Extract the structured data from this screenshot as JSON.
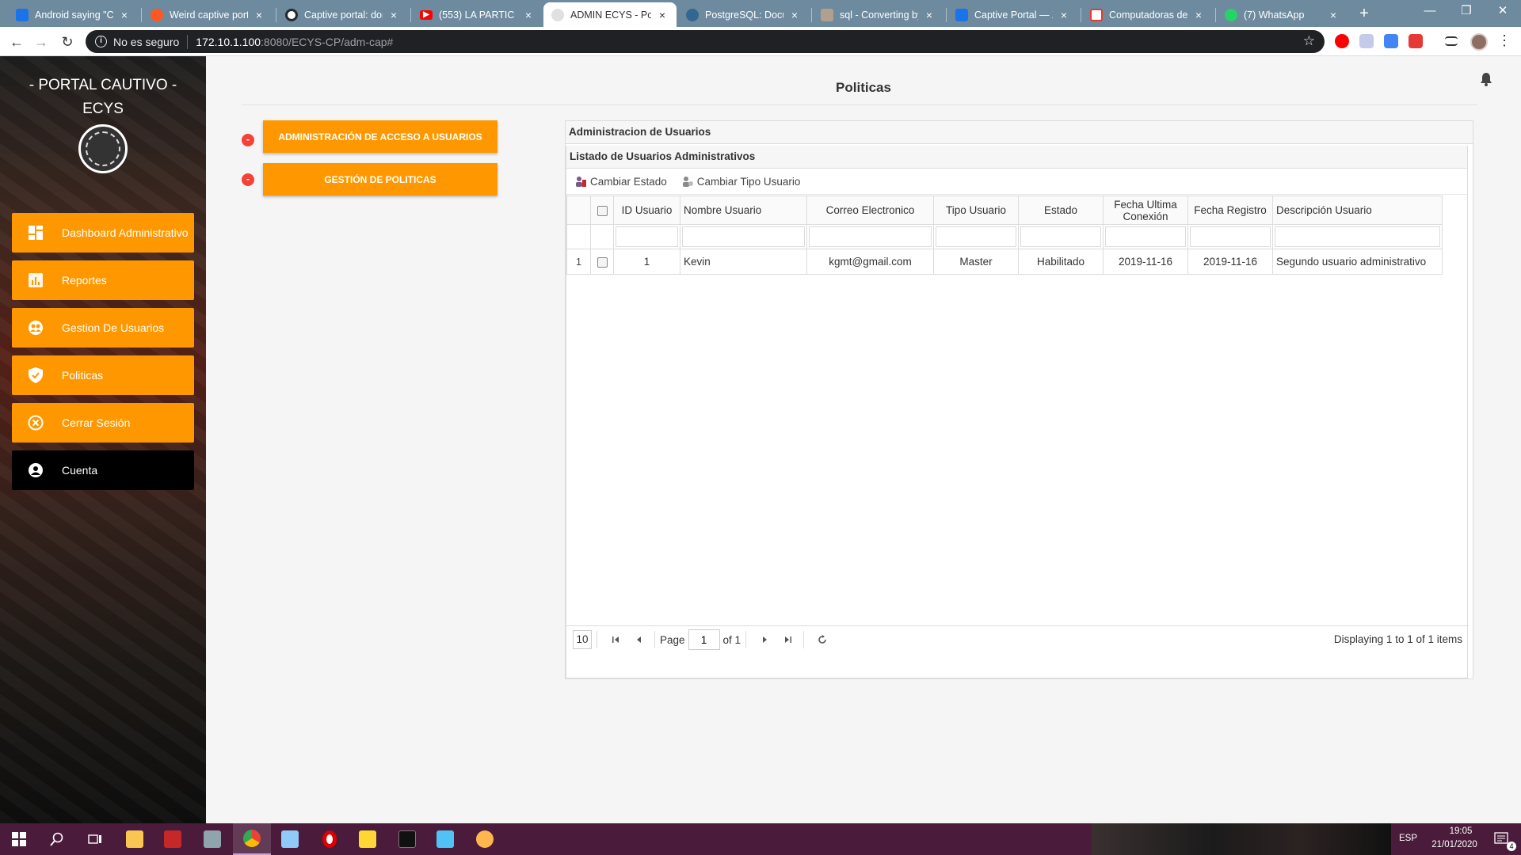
{
  "browser": {
    "tabs": [
      {
        "title": "Android saying \"Co",
        "favicon_color": "#1a73e8"
      },
      {
        "title": "Weird captive porta",
        "favicon_color": "#ff5722"
      },
      {
        "title": "Captive portal: don",
        "favicon_color": "#24292e"
      },
      {
        "title": "(553) LA PARTIC",
        "favicon_color": "#ff0000"
      },
      {
        "title": "ADMIN ECYS - Port",
        "favicon_color": "#9e9e9e"
      },
      {
        "title": "PostgreSQL: Docum",
        "favicon_color": "#336791"
      },
      {
        "title": "sql - Converting by",
        "favicon_color": "#b0a090"
      },
      {
        "title": "Captive Portal — Ze",
        "favicon_color": "#1a73e8"
      },
      {
        "title": "Computadoras de E",
        "favicon_color": "#e53935"
      },
      {
        "title": "(7) WhatsApp",
        "favicon_color": "#25d366"
      }
    ],
    "active_tab_index": 4,
    "security_label": "No es seguro",
    "url_host": "172.10.1.100",
    "url_path": ":8080/ECYS-CP/adm-cap#"
  },
  "sidebar": {
    "brand_line1": "- PORTAL CAUTIVO -",
    "brand_line2": "ECYS",
    "items": [
      {
        "label": "Dashboard Administrativo",
        "icon": "dashboard-icon"
      },
      {
        "label": "Reportes",
        "icon": "chart-icon"
      },
      {
        "label": "Gestion De Usuarios",
        "icon": "users-icon"
      },
      {
        "label": "Politicas",
        "icon": "shield-check-icon"
      },
      {
        "label": "Cerrar Sesión",
        "icon": "close-circle-icon"
      },
      {
        "label": "Cuenta",
        "icon": "account-icon"
      }
    ]
  },
  "main": {
    "title": "Politicas",
    "accordion": [
      {
        "label": "ADMINISTRACIÓN DE ACCESO A USUARIOS",
        "toggle": "-"
      },
      {
        "label": "GESTIÓN DE POLITICAS",
        "toggle": "-"
      }
    ],
    "panel_title": "Administracion de Usuarios",
    "grid_title": "Listado de Usuarios Administrativos",
    "tools": [
      {
        "label": "Cambiar Estado",
        "icon": "user-status-icon"
      },
      {
        "label": "Cambiar Tipo Usuario",
        "icon": "user-type-icon"
      }
    ],
    "columns": [
      "ID Usuario",
      "Nombre Usuario",
      "Correo Electronico",
      "Tipo Usuario",
      "Estado",
      "Fecha Ultima Conexión",
      "Fecha Registro",
      "Descripción Usuario"
    ],
    "rows": [
      {
        "rownum": "1",
        "id": "1",
        "nombre": "Kevin",
        "correo": "kgmt@gmail.com",
        "tipo": "Master",
        "estado": "Habilitado",
        "ultima": "2019-11-16",
        "registro": "2019-11-16",
        "descripcion": "Segundo usuario administrativo"
      }
    ],
    "pager": {
      "page_size": "10",
      "page_label": "Page",
      "page_value": "1",
      "of_label": "of 1",
      "info": "Displaying 1 to 1 of 1 items"
    }
  },
  "taskbar": {
    "lang": "ESP",
    "time": "19:05",
    "date": "21/01/2020",
    "notifications": "4"
  },
  "colors": {
    "accent": "#ff9800",
    "accordion_toggle": "#f44336",
    "taskbar": "#4a1b3b"
  }
}
